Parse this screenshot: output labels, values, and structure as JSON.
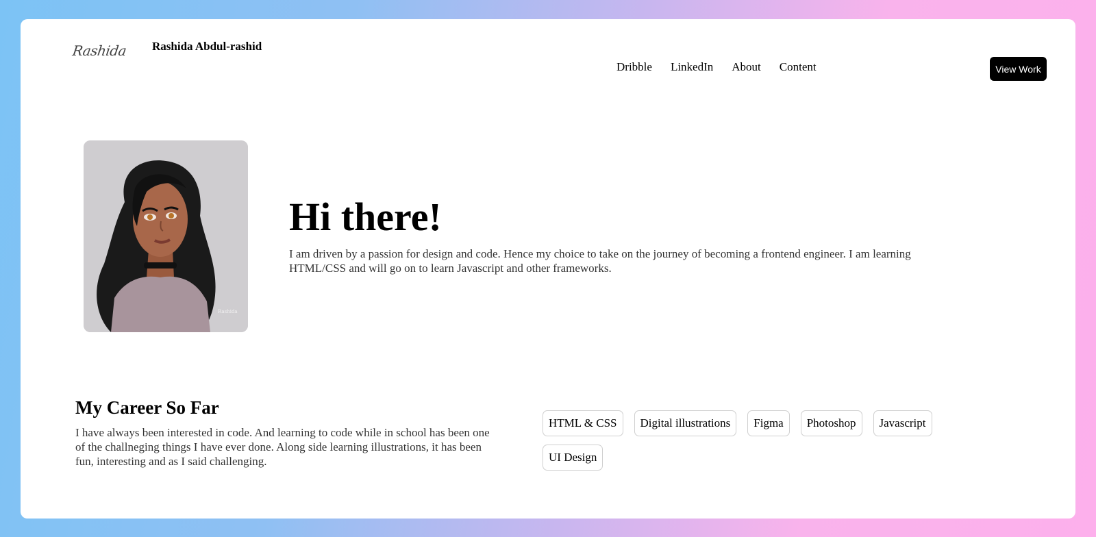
{
  "header": {
    "logo_text": "Rashida",
    "site_name": "Rashida Abdul-rashid",
    "nav": [
      "Dribble",
      "LinkedIn",
      "About",
      "Content"
    ],
    "cta_label": "View Work"
  },
  "hero": {
    "title": "Hi there!",
    "text": "I am driven by a passion for design and code. Hence my choice to take on the journey of becoming a frontend engineer. I am learning HTML/CSS and will go on to learn Javascript and other frameworks.",
    "avatar_signature": "Rashida"
  },
  "career": {
    "title": "My Career So Far",
    "text": "I have always been interested in code. And learning to code while in school has been one of the challneging things I have ever done. Along side learning illustrations, it has been fun, interesting and as I said challenging."
  },
  "skills": [
    "HTML & CSS",
    "Digital illustrations",
    "Figma",
    "Photoshop",
    "Javascript",
    "UI Design"
  ],
  "colors": {
    "background_start": "#7cc3f5",
    "background_end": "#fdb0ec",
    "card": "#ffffff",
    "button": "#000000"
  }
}
